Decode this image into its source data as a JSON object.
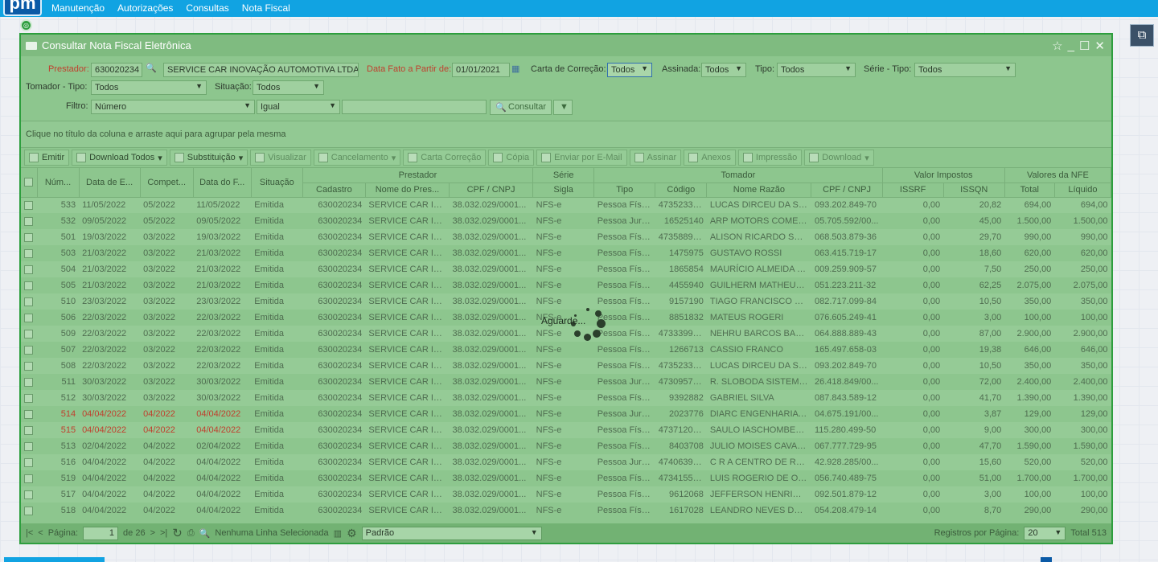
{
  "app": {
    "logo": "pm"
  },
  "menu": [
    "Manutenção",
    "Autorizações",
    "Consultas",
    "Nota Fiscal"
  ],
  "window": {
    "title": "Consultar Nota Fiscal Eletrônica"
  },
  "filters": {
    "prestador_label": "Prestador:",
    "prestador_code": "630020234",
    "prestador_name": "SERVICE CAR INOVAÇÃO AUTOMOTIVA LTDA",
    "data_fato_label": "Data Fato a Partir de:",
    "data_fato_value": "01/01/2021",
    "carta_label": "Carta de Correção:",
    "carta_value": "Todos",
    "assinada_label": "Assinada:",
    "assinada_value": "Todos",
    "tipo_label": "Tipo:",
    "tipo_value": "Todos",
    "serie_label": "Série - Tipo:",
    "serie_value": "Todos",
    "tomador_label": "Tomador - Tipo:",
    "tomador_value": "Todos",
    "situacao_label": "Situação:",
    "situacao_value": "Todos",
    "filtro_label": "Filtro:",
    "filtro_field": "Número",
    "filtro_op": "Igual",
    "filtro_value": "",
    "consultar": "Consultar"
  },
  "group_hint": "Clique no título da coluna e arraste aqui para agrupar pela mesma",
  "toolbar": [
    {
      "label": "Emitir",
      "enabled": true,
      "dropdown": false
    },
    {
      "label": "Download Todos",
      "enabled": true,
      "dropdown": true
    },
    {
      "label": "Substituição",
      "enabled": true,
      "dropdown": true
    },
    {
      "label": "Visualizar",
      "enabled": false,
      "dropdown": false
    },
    {
      "label": "Cancelamento",
      "enabled": false,
      "dropdown": true
    },
    {
      "label": "Carta Correção",
      "enabled": false,
      "dropdown": false
    },
    {
      "label": "Cópia",
      "enabled": false,
      "dropdown": false
    },
    {
      "label": "Enviar por E-Mail",
      "enabled": false,
      "dropdown": false
    },
    {
      "label": "Assinar",
      "enabled": false,
      "dropdown": false
    },
    {
      "label": "Anexos",
      "enabled": false,
      "dropdown": false
    },
    {
      "label": "Impressão",
      "enabled": false,
      "dropdown": false
    },
    {
      "label": "Download",
      "enabled": false,
      "dropdown": true
    }
  ],
  "table": {
    "groups": {
      "prestador": "Prestador",
      "serie": "Série",
      "tomador": "Tomador",
      "impostos": "Valor Impostos",
      "nfe": "Valores da NFE"
    },
    "columns": {
      "num": "Núm...",
      "data_emissao": "Data de E...",
      "competencia": "Compet...",
      "data_fato": "Data do F...",
      "situacao": "Situação",
      "cadastro": "Cadastro",
      "nome_prest": "Nome do Pres...",
      "cpf_prest": "CPF / CNPJ",
      "sigla": "Sigla",
      "tipo": "Tipo",
      "codigo": "Código",
      "razao": "Nome Razão",
      "cpf_tom": "CPF / CNPJ",
      "issrf": "ISSRF",
      "issqn": "ISSQN",
      "total": "Total",
      "liquido": "Líquido"
    },
    "rows": [
      [
        "533",
        "11/05/2022",
        "05/2022",
        "11/05/2022",
        "Emitida",
        "630020234",
        "SERVICE CAR INO...",
        "38.032.029/0001...",
        "NFS-e",
        "Pessoa Física",
        "47352337...",
        "LUCAS DIRCEU DA SIL...",
        "093.202.849-70",
        "0,00",
        "20,82",
        "694,00",
        "694,00"
      ],
      [
        "532",
        "09/05/2022",
        "05/2022",
        "09/05/2022",
        "Emitida",
        "630020234",
        "SERVICE CAR INO...",
        "38.032.029/0001...",
        "NFS-e",
        "Pessoa Jurid...",
        "16525140",
        "ARP MOTORS COMER...",
        "05.705.592/00...",
        "0,00",
        "45,00",
        "1.500,00",
        "1.500,00"
      ],
      [
        "501",
        "19/03/2022",
        "03/2022",
        "19/03/2022",
        "Emitida",
        "630020234",
        "SERVICE CAR INO...",
        "38.032.029/0001...",
        "NFS-e",
        "Pessoa Física",
        "47358898...",
        "ALISON RICARDO SAR...",
        "068.503.879-36",
        "0,00",
        "29,70",
        "990,00",
        "990,00"
      ],
      [
        "503",
        "21/03/2022",
        "03/2022",
        "21/03/2022",
        "Emitida",
        "630020234",
        "SERVICE CAR INO...",
        "38.032.029/0001...",
        "NFS-e",
        "Pessoa Física",
        "1475975",
        "GUSTAVO ROSSI",
        "063.415.719-17",
        "0,00",
        "18,60",
        "620,00",
        "620,00"
      ],
      [
        "504",
        "21/03/2022",
        "03/2022",
        "21/03/2022",
        "Emitida",
        "630020234",
        "SERVICE CAR INO...",
        "38.032.029/0001...",
        "NFS-e",
        "Pessoa Física",
        "1865854",
        "MAURÍCIO ALMEIDA S...",
        "009.259.909-57",
        "0,00",
        "7,50",
        "250,00",
        "250,00"
      ],
      [
        "505",
        "21/03/2022",
        "03/2022",
        "21/03/2022",
        "Emitida",
        "630020234",
        "SERVICE CAR INO...",
        "38.032.029/0001...",
        "NFS-e",
        "Pessoa Física",
        "4455940",
        "GUILHERM MATHEUS ...",
        "051.223.211-32",
        "0,00",
        "62,25",
        "2.075,00",
        "2.075,00"
      ],
      [
        "510",
        "23/03/2022",
        "03/2022",
        "23/03/2022",
        "Emitida",
        "630020234",
        "SERVICE CAR INO...",
        "38.032.029/0001...",
        "NFS-e",
        "Pessoa Física",
        "9157190",
        "TIAGO FRANCISCO CA...",
        "082.717.099-84",
        "0,00",
        "10,50",
        "350,00",
        "350,00"
      ],
      [
        "506",
        "22/03/2022",
        "03/2022",
        "22/03/2022",
        "Emitida",
        "630020234",
        "SERVICE CAR INO...",
        "38.032.029/0001...",
        "NFS-e",
        "Pessoa Física",
        "8851832",
        "MATEUS ROGERI",
        "076.605.249-41",
        "0,00",
        "3,00",
        "100,00",
        "100,00"
      ],
      [
        "509",
        "22/03/2022",
        "03/2022",
        "22/03/2022",
        "Emitida",
        "630020234",
        "SERVICE CAR INO...",
        "38.032.029/0001...",
        "NFS-e",
        "Pessoa Física",
        "47333993...",
        "NEHRU BARCOS BALB...",
        "064.888.889-43",
        "0,00",
        "87,00",
        "2.900,00",
        "2.900,00"
      ],
      [
        "507",
        "22/03/2022",
        "03/2022",
        "22/03/2022",
        "Emitida",
        "630020234",
        "SERVICE CAR INO...",
        "38.032.029/0001...",
        "NFS-e",
        "Pessoa Física",
        "1266713",
        "CASSIO FRANCO",
        "165.497.658-03",
        "0,00",
        "19,38",
        "646,00",
        "646,00"
      ],
      [
        "508",
        "22/03/2022",
        "03/2022",
        "22/03/2022",
        "Emitida",
        "630020234",
        "SERVICE CAR INO...",
        "38.032.029/0001...",
        "NFS-e",
        "Pessoa Física",
        "47352337...",
        "LUCAS DIRCEU DA SIL...",
        "093.202.849-70",
        "0,00",
        "10,50",
        "350,00",
        "350,00"
      ],
      [
        "511",
        "30/03/2022",
        "03/2022",
        "30/03/2022",
        "Emitida",
        "630020234",
        "SERVICE CAR INO...",
        "38.032.029/0001...",
        "NFS-e",
        "Pessoa Jurid...",
        "47309570...",
        "R. SLOBODA SISTEMA ...",
        "26.418.849/00...",
        "0,00",
        "72,00",
        "2.400,00",
        "2.400,00"
      ],
      [
        "512",
        "30/03/2022",
        "03/2022",
        "30/03/2022",
        "Emitida",
        "630020234",
        "SERVICE CAR INO...",
        "38.032.029/0001...",
        "NFS-e",
        "Pessoa Física",
        "9392882",
        "GABRIEL SILVA",
        "087.843.589-12",
        "0,00",
        "41,70",
        "1.390,00",
        "1.390,00"
      ],
      [
        "514",
        "04/04/2022",
        "04/2022",
        "04/04/2022",
        "Emitida",
        "630020234",
        "SERVICE CAR INO...",
        "38.032.029/0001...",
        "NFS-e",
        "Pessoa Jurid...",
        "2023776",
        "DIARC ENGENHARIA E...",
        "04.675.191/00...",
        "0,00",
        "3,87",
        "129,00",
        "129,00"
      ],
      [
        "515",
        "04/04/2022",
        "04/2022",
        "04/04/2022",
        "Emitida",
        "630020234",
        "SERVICE CAR INO...",
        "38.032.029/0001...",
        "NFS-e",
        "Pessoa Física",
        "47371200...",
        "SAULO IASCHOMBEC...",
        "115.280.499-50",
        "0,00",
        "9,00",
        "300,00",
        "300,00"
      ],
      [
        "513",
        "02/04/2022",
        "04/2022",
        "02/04/2022",
        "Emitida",
        "630020234",
        "SERVICE CAR INO...",
        "38.032.029/0001...",
        "NFS-e",
        "Pessoa Física",
        "8403708",
        "JULIO MOISES CAVALH...",
        "067.777.729-95",
        "0,00",
        "47,70",
        "1.590,00",
        "1.590,00"
      ],
      [
        "516",
        "04/04/2022",
        "04/2022",
        "04/04/2022",
        "Emitida",
        "630020234",
        "SERVICE CAR INO...",
        "38.032.029/0001...",
        "NFS-e",
        "Pessoa Jurid...",
        "47406398...",
        "C R A CENTRO DE REP...",
        "42.928.285/00...",
        "0,00",
        "15,60",
        "520,00",
        "520,00"
      ],
      [
        "519",
        "04/04/2022",
        "04/2022",
        "04/04/2022",
        "Emitida",
        "630020234",
        "SERVICE CAR INO...",
        "38.032.029/0001...",
        "NFS-e",
        "Pessoa Física",
        "47341556...",
        "LUIS ROGERIO DE OLI...",
        "056.740.489-75",
        "0,00",
        "51,00",
        "1.700,00",
        "1.700,00"
      ],
      [
        "517",
        "04/04/2022",
        "04/2022",
        "04/04/2022",
        "Emitida",
        "630020234",
        "SERVICE CAR INO...",
        "38.032.029/0001...",
        "NFS-e",
        "Pessoa Física",
        "9612068",
        "JEFFERSON HENRIQUE...",
        "092.501.879-12",
        "0,00",
        "3,00",
        "100,00",
        "100,00"
      ],
      [
        "518",
        "04/04/2022",
        "04/2022",
        "04/04/2022",
        "Emitida",
        "630020234",
        "SERVICE CAR INO...",
        "38.032.029/0001...",
        "NFS-e",
        "Pessoa Física",
        "1617028",
        "LEANDRO NEVES DA S...",
        "054.208.479-14",
        "0,00",
        "8,70",
        "290,00",
        "290,00"
      ]
    ]
  },
  "loading": {
    "label": "Aguarde..."
  },
  "pager": {
    "page_label": "Página:",
    "page_value": "1",
    "of_label": "de 26",
    "selection": "Nenhuma Linha Selecionada",
    "layout_value": "Padrão",
    "per_page_label": "Registros por Página:",
    "per_page_value": "20",
    "total": "Total 513"
  }
}
